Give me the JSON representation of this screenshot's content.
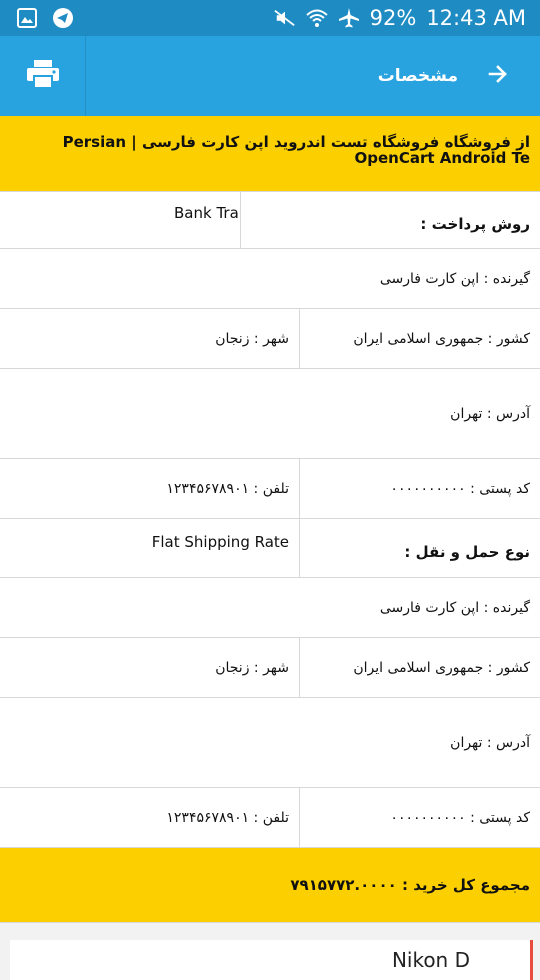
{
  "status": {
    "battery": "92%",
    "time": "12:43 AM"
  },
  "appbar": {
    "title": "مشخصات"
  },
  "store_banner": "از فروشگاه فروشگاه تست اندروید اپن کارت فارسی | Persian OpenCart Android Te",
  "payment": {
    "label": "روش پرداخت :",
    "value": "Bank Tra"
  },
  "payment_address": {
    "recipient": "گیرنده : اپن کارت فارسی",
    "country": "کشور : جمهوری اسلامی ایران",
    "city": "شهر : زنجان",
    "address": "آدرس : تهران",
    "postal": "کد پستی : ۰۰۰۰۰۰۰۰۰۰",
    "phone": "تلفن : ۱۲۳۴۵۶۷۸۹۰۱"
  },
  "shipping": {
    "label": "نوع حمل و نقل :",
    "value": "Flat Shipping Rate"
  },
  "shipping_address": {
    "recipient": "گیرنده : اپن کارت فارسی",
    "country": "کشور : جمهوری اسلامی ایران",
    "city": "شهر : زنجان",
    "address": "آدرس : تهران",
    "postal": "کد پستی : ۰۰۰۰۰۰۰۰۰۰",
    "phone": "تلفن : ۱۲۳۴۵۶۷۸۹۰۱"
  },
  "total": "مجموع کل خرید : ۷۹۱۵۷۷۲.۰۰۰۰",
  "bottom_card": {
    "text": "Nikon D"
  },
  "colors": {
    "statusbar": "#1e8bc3",
    "appbar": "#29a3df",
    "highlight": "#fcd000"
  }
}
